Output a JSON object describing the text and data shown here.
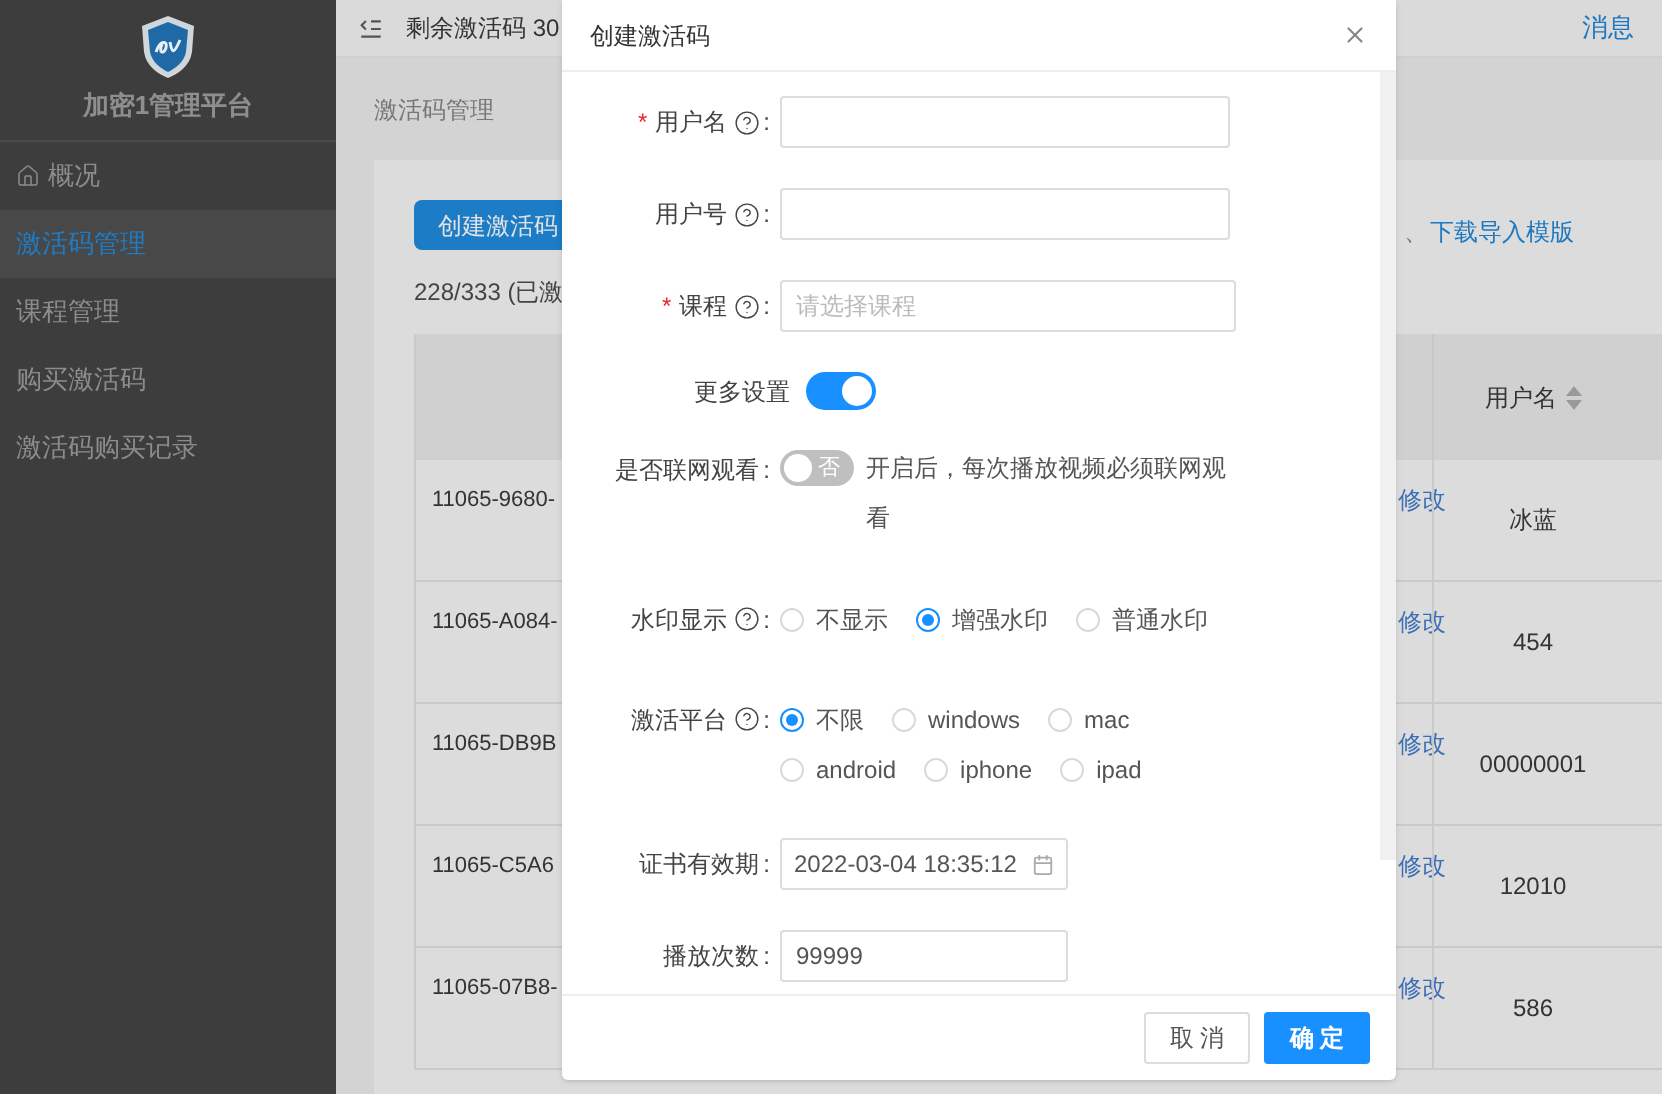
{
  "sidebar": {
    "title": "加密1管理平台",
    "items": [
      {
        "label": "概况",
        "selected": false
      },
      {
        "label": "激活码管理",
        "selected": true
      },
      {
        "label": "课程管理",
        "selected": false
      },
      {
        "label": "购买激活码",
        "selected": false
      },
      {
        "label": "激活码购买记录",
        "selected": false
      }
    ]
  },
  "header": {
    "remaining": "剩余激活码 30",
    "messages": "消息"
  },
  "breadcrumb": "激活码管理",
  "toolbar": {
    "create_button": "创建激活码",
    "separator": "、",
    "download_link": "下载导入模版"
  },
  "summary": "228/333 (已激",
  "table": {
    "columns": [
      "用户名"
    ],
    "rows": [
      {
        "code": "11065-9680-",
        "action": "修改",
        "username": "冰蓝"
      },
      {
        "code": "11065-A084-",
        "action": "修改",
        "username": "454"
      },
      {
        "code": "11065-DB9B",
        "action": "修改",
        "username": "00000001"
      },
      {
        "code": "11065-C5A6",
        "action": "修改",
        "username": "12010"
      },
      {
        "code": "11065-07B8-",
        "action": "修改",
        "username": "586"
      }
    ]
  },
  "dialog": {
    "title": "创建激活码",
    "fields": [
      {
        "kind": "input",
        "label": "用户名",
        "mark": "*",
        "help": true,
        "colon": ":"
      },
      {
        "kind": "input",
        "label": "用户号",
        "help": true,
        "colon": ":"
      },
      {
        "kind": "select",
        "label": "课程",
        "mark": "*",
        "help": true,
        "colon": ":",
        "placeholder": "请选择课程"
      },
      {
        "kind": "switch",
        "label": "更多设置",
        "on": true
      },
      {
        "kind": "toggle",
        "label": "是否联网观看",
        "colon": ":",
        "on": false,
        "off_text": "否",
        "note": "开启后，每次播放视频必须联网观看"
      },
      {
        "kind": "radio",
        "label": "水印显示",
        "help": true,
        "colon": ":",
        "options": [
          {
            "label": "不显示",
            "selected": false
          },
          {
            "label": "增强水印",
            "selected": true
          },
          {
            "label": "普通水印",
            "selected": false
          }
        ]
      },
      {
        "kind": "radio",
        "label": "激活平台",
        "help": true,
        "colon": ":",
        "options": [
          {
            "label": "不限",
            "selected": true
          },
          {
            "label": "windows",
            "selected": false
          },
          {
            "label": "mac",
            "selected": false
          },
          {
            "label": "android",
            "selected": false
          },
          {
            "label": "iphone",
            "selected": false
          },
          {
            "label": "ipad",
            "selected": false
          }
        ]
      },
      {
        "kind": "date",
        "label": "证书有效期",
        "colon": ":",
        "value": "2022-03-04 18:35:12"
      },
      {
        "kind": "input",
        "label": "播放次数",
        "colon": ":",
        "value": "99999",
        "short": true
      }
    ],
    "cancel": "取 消",
    "confirm": "确 定"
  }
}
